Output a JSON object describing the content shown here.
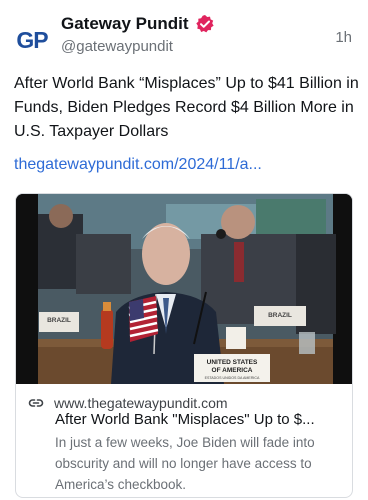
{
  "account": {
    "avatar_text": "GP",
    "name": "Gateway Pundit",
    "handle": "@gatewaypundit",
    "time": "1h",
    "verified_icon": "verified-badge-icon",
    "verified_color": "#e0245e"
  },
  "post": {
    "text": "After World Bank “Misplaces” Up to $41 Billion in Funds, Biden Pledges Record $4 Billion More in U.S. Taxpayer Dollars",
    "link": "thegatewaypundit.com/2024/11/a..."
  },
  "card": {
    "image_placard_line1": "UNITED STATES",
    "image_placard_line2": "OF AMERICA",
    "image_placard_line3": "ESTADOS UNIDOS DA AMERICA",
    "image_sign_left": "BRAZIL",
    "image_sign_right": "BRAZIL",
    "link_icon": "link-icon",
    "domain": "www.thegatewaypundit.com",
    "title": "After World Bank \"Misplaces\" Up to $...",
    "description": "In just a few weeks, Joe Biden will fade into obscurity and will no longer have access to America’s checkbook."
  },
  "colors": {
    "link": "#2e6bd6",
    "avatar": "#1f4e9c",
    "secondary_text": "#6b7076"
  }
}
